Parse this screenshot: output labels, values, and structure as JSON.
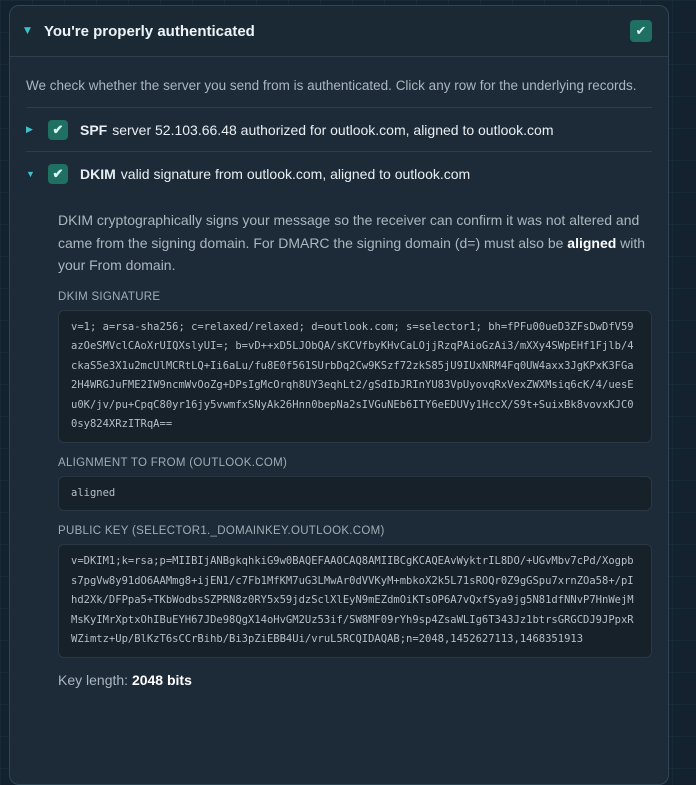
{
  "panel": {
    "title": "You're properly authenticated",
    "check_glyph": "✔",
    "caret_glyph": "▼",
    "intro": "We check whether the server you send from is authenticated. Click any row for the underlying records."
  },
  "rows": [
    {
      "name": "SPF",
      "text": "server 52.103.66.48 authorized for outlook.com, aligned to outlook.com",
      "caret": "▶",
      "expanded": false
    },
    {
      "name": "DKIM",
      "text": "valid signature from outlook.com, aligned to outlook.com",
      "caret": "▼",
      "expanded": true
    }
  ],
  "dkim": {
    "explain_pre": "DKIM cryptographically signs your message so the receiver can confirm it was not altered and came from the signing domain. For DMARC the signing domain (d=) must also be ",
    "explain_bold": "aligned",
    "explain_post": " with your From domain.",
    "signature_label": "DKIM SIGNATURE",
    "signature": "v=1; a=rsa-sha256; c=relaxed/relaxed; d=outlook.com; s=selector1; bh=fPFu00ueD3ZFsDwDfV59azOeSMVclCAoXrUIQXslyUI=; b=vD++xD5LJObQA/sKCVfbyKHvCaLOjjRzqPAioGzAi3/mXXy4SWpEHf1Fjlb/4ckaS5e3X1u2mcUlMCRtLQ+Ii6aLu/fu8E0f561SUrbDq2Cw9KSzf72zkS85jU9IUxNRM4Fq0UW4axx3JgKPxK3FGa2H4WRGJuFME2IW9ncmWvOoZg+DPsIgMcOrqh8UY3eqhLt2/gSdIbJRInYU83VpUyovqRxVexZWXMsiq6cK/4/uesEu0K/jv/pu+CpqC80yr16jy5vwmfxSNyAk26Hnn0bepNa2sIVGuNEb6ITY6eEDUVy1HccX/S9t+SuixBk8vovxKJC00sy824XRzITRqA==",
    "alignment_label": "ALIGNMENT TO FROM (OUTLOOK.COM)",
    "alignment": "aligned",
    "pubkey_label": "PUBLIC KEY (SELECTOR1._DOMAINKEY.OUTLOOK.COM)",
    "pubkey": "v=DKIM1;k=rsa;p=MIIBIjANBgkqhkiG9w0BAQEFAAOCAQ8AMIIBCgKCAQEAvWyktrIL8DO/+UGvMbv7cPd/Xogpbs7pgVw8y91dO6AAMmg8+ijEN1/c7Fb1MfKM7uG3LMwAr0dVVKyM+mbkoX2k5L71sROQr0Z9gGSpu7xrnZOa58+/pIhd2Xk/DFPpa5+TKbWodbsSZPRN8z0RY5x59jdzSclXlEyN9mEZdmOiKTsOP6A7vQxfSya9jg5N81dfNNvP7HnWejMMsKyIMrXptxOhIBuEYH67JDe98QgX14oHvGM2Uz53if/SW8MF09rYh9sp4ZsaWLIg6T343Jz1btrsGRGCDJ9JPpxRWZimtz+Up/BlKzT6sCCrBihb/Bi3pZiEBB4Ui/vruL5RCQIDAQAB;n=2048,1452627113,1468351913",
    "keylen_label": "Key length: ",
    "keylen_value": "2048 bits"
  }
}
